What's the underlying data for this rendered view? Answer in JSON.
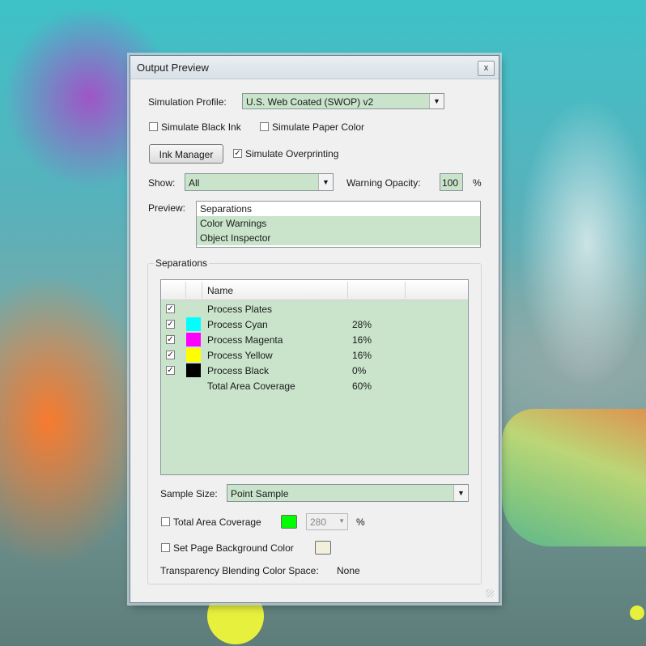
{
  "window": {
    "title": "Output Preview",
    "close_glyph": "x"
  },
  "simulation_profile": {
    "label": "Simulation Profile:",
    "value": "U.S. Web Coated (SWOP) v2"
  },
  "checkboxes": {
    "simulate_black_ink": {
      "label": "Simulate Black Ink",
      "checked": false
    },
    "simulate_paper_color": {
      "label": "Simulate Paper Color",
      "checked": false
    },
    "simulate_overprinting": {
      "label": "Simulate Overprinting",
      "checked": true
    }
  },
  "ink_manager_button": "Ink Manager",
  "show": {
    "label": "Show:",
    "value": "All"
  },
  "warning_opacity": {
    "label": "Warning Opacity:",
    "value": "100",
    "unit": "%"
  },
  "preview": {
    "label": "Preview:",
    "options": [
      "Separations",
      "Color Warnings",
      "Object Inspector"
    ],
    "selected": "Separations"
  },
  "separations": {
    "group_label": "Separations",
    "column_name": "Name",
    "rows": [
      {
        "name": "Process Plates",
        "checked": true,
        "swatch": null,
        "pct": ""
      },
      {
        "name": "Process Cyan",
        "checked": true,
        "swatch": "#00ffff",
        "pct": "28%"
      },
      {
        "name": "Process Magenta",
        "checked": true,
        "swatch": "#ff00ff",
        "pct": "16%"
      },
      {
        "name": "Process Yellow",
        "checked": true,
        "swatch": "#ffff00",
        "pct": "16%"
      },
      {
        "name": "Process Black",
        "checked": true,
        "swatch": "#000000",
        "pct": "0%"
      },
      {
        "name": "Total Area Coverage",
        "checked": false,
        "swatch": null,
        "pct": "60%"
      }
    ]
  },
  "sample_size": {
    "label": "Sample Size:",
    "value": "Point Sample"
  },
  "total_area_coverage": {
    "label": "Total Area Coverage",
    "checked": false,
    "color": "#00ff00",
    "value": "280",
    "unit": "%"
  },
  "page_background": {
    "label": "Set Page Background Color",
    "checked": false,
    "color": "#f2f0dc"
  },
  "transparency_blending": {
    "label": "Transparency Blending Color Space:",
    "value": "None"
  },
  "colors": {
    "field_selection": "#c9e4cb",
    "dialog_bg": "#f0f0f0"
  }
}
